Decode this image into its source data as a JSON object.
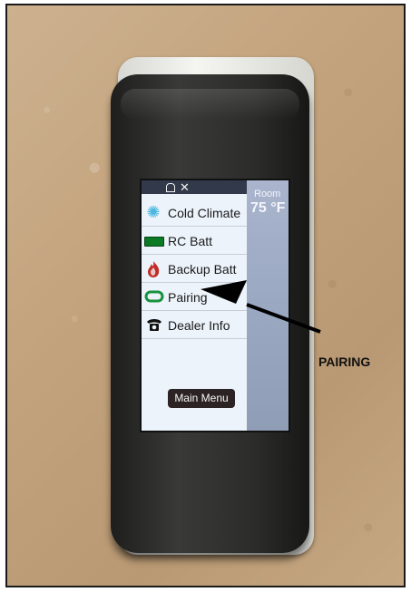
{
  "screen": {
    "room_label": "Room",
    "room_temperature": "75 °F",
    "menu_items": [
      {
        "label": "Cold Climate",
        "icon": "snowflake-icon"
      },
      {
        "label": "RC Batt",
        "icon": "battery-icon"
      },
      {
        "label": "Backup Batt",
        "icon": "flame-icon"
      },
      {
        "label": "Pairing",
        "icon": "pairing-icon"
      },
      {
        "label": "Dealer Info",
        "icon": "phone-icon"
      }
    ],
    "main_menu_label": "Main Menu"
  },
  "callout": {
    "label": "PAIRING"
  },
  "colors": {
    "screen_background": "#ecf3fa",
    "sidebar": "#9aa8c2",
    "button": "#2c2324",
    "battery": "#0b7a25",
    "flame": "#c12c28",
    "pairing": "#16923d"
  }
}
